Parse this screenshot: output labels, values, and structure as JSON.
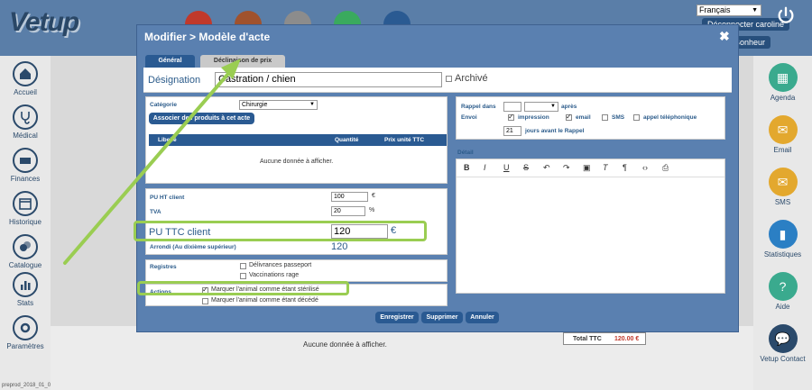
{
  "app": {
    "logo": "Vetup",
    "language": "Français",
    "user_button": "Déconnecter caroline",
    "second_button": "Bonheur",
    "version": "preprod_2018_01_08_2307"
  },
  "left_nav": [
    {
      "label": "Accueil",
      "icon": "home-icon"
    },
    {
      "label": "Médical",
      "icon": "stethoscope-icon"
    },
    {
      "label": "Finances",
      "icon": "finance-icon"
    },
    {
      "label": "Historique",
      "icon": "calendar-icon"
    },
    {
      "label": "Catalogue",
      "icon": "catalogue-icon"
    },
    {
      "label": "Stats",
      "icon": "stats-icon"
    },
    {
      "label": "Paramètres",
      "icon": "settings-icon"
    }
  ],
  "right_nav": [
    {
      "label": "Agenda",
      "icon": "agenda-icon",
      "color": "#3aaa8e"
    },
    {
      "label": "Email",
      "icon": "email-icon",
      "color": "#e3a82e"
    },
    {
      "label": "SMS",
      "icon": "sms-icon",
      "color": "#e3a82e"
    },
    {
      "label": "Statistiques",
      "icon": "chart-icon",
      "color": "#2b7fc4"
    },
    {
      "label": "Aide",
      "icon": "help-icon",
      "color": "#3aaa8e"
    },
    {
      "label": "Vetup Contact",
      "icon": "chat-icon",
      "color": "#2b4a6b"
    }
  ],
  "background": {
    "empty_text": "Aucune donnée à afficher.",
    "total_label": "Total TTC",
    "total_value": "120.00 €"
  },
  "modal": {
    "title": "Modifier > Modèle d'acte",
    "close": "✖",
    "tabs": [
      "Général",
      "Déclinaison de prix"
    ],
    "designation_label": "Désignation",
    "designation_value": "Castration / chien",
    "archive_label": "Archivé",
    "category_label": "Catégorie",
    "category_value": "Chirurgie",
    "associate_button": "Associer des produits à cet acte",
    "table_headers": {
      "libelle": "Libellé",
      "quantite": "Quantité",
      "prix": "Prix unité TTC"
    },
    "table_empty": "Aucune donnée à afficher.",
    "pu_ht_label": "PU HT client",
    "pu_ht_value": "100",
    "currency": "€",
    "tva_label": "TVA",
    "tva_value": "20",
    "percent": "%",
    "pu_ttc_label": "PU TTC client",
    "pu_ttc_value": "120",
    "arrondi_label": "Arrondi (Au dixième supérieur)",
    "arrondi_value": "120",
    "registres_label": "Registres",
    "registres": [
      "Délivrances passeport",
      "Vaccinations rage"
    ],
    "actions_label": "Actions",
    "actions": [
      "Marquer l'animal comme étant stérilisé",
      "Marquer l'animal comme étant décédé"
    ],
    "rappel_label": "Rappel dans",
    "apres": "après",
    "envoi_label": "Envoi",
    "envoi_options": [
      "impression",
      "email",
      "SMS",
      "appel téléphonique"
    ],
    "jours_value": "21",
    "jours_text": "jours avant le Rappel",
    "detail_label": "Détail",
    "buttons": {
      "save": "Enregistrer",
      "delete": "Supprimer",
      "cancel": "Annuler"
    }
  }
}
